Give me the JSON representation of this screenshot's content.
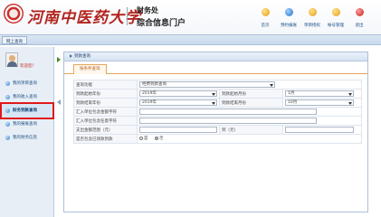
{
  "header": {
    "university_name": "河南中医药大学",
    "department": "财务处",
    "portal_name": "综合信息门户",
    "nav": [
      {
        "label": "首页",
        "icon": "home-icon"
      },
      {
        "label": "预约报账",
        "icon": "booking-icon"
      },
      {
        "label": "项目授权",
        "icon": "authorize-icon"
      },
      {
        "label": "帐号管理",
        "icon": "account-icon"
      },
      {
        "label": "退出",
        "icon": "logout-icon"
      }
    ]
  },
  "topbar": {
    "tab_label": "网上查询"
  },
  "sidebar": {
    "welcome": "欢迎您！",
    "items": [
      {
        "label": "我的项目查询",
        "active": false
      },
      {
        "label": "我的收入查询",
        "active": false
      },
      {
        "label": "财务到款查询",
        "active": true
      },
      {
        "label": "我的报账查询",
        "active": false
      },
      {
        "label": "我的财务信息",
        "active": false
      }
    ]
  },
  "main": {
    "title": "到款查询",
    "subtab": "按条件查询",
    "form": {
      "query_function_label": "查询功能",
      "query_function_value": "经费到款查询",
      "start_year_label": "到款起始年份",
      "start_year_value": "2019年",
      "start_month_label": "到款起始月份",
      "start_month_value": "1月",
      "end_year_label": "到款结束年份",
      "end_year_value": "2019年",
      "end_month_label": "到款结束月份",
      "end_month_value": "10月",
      "payer_account_label": "汇入单位包含金额字符",
      "payer_name_label": "汇入单位包含任意字符",
      "amount_range_label": "支出金额范围（元）",
      "amount_to_label": "到（元）",
      "include_claimed_label": "是否包含已领款到款",
      "radio_yes": "是",
      "radio_no": "否",
      "radio_selected": "否"
    }
  }
}
